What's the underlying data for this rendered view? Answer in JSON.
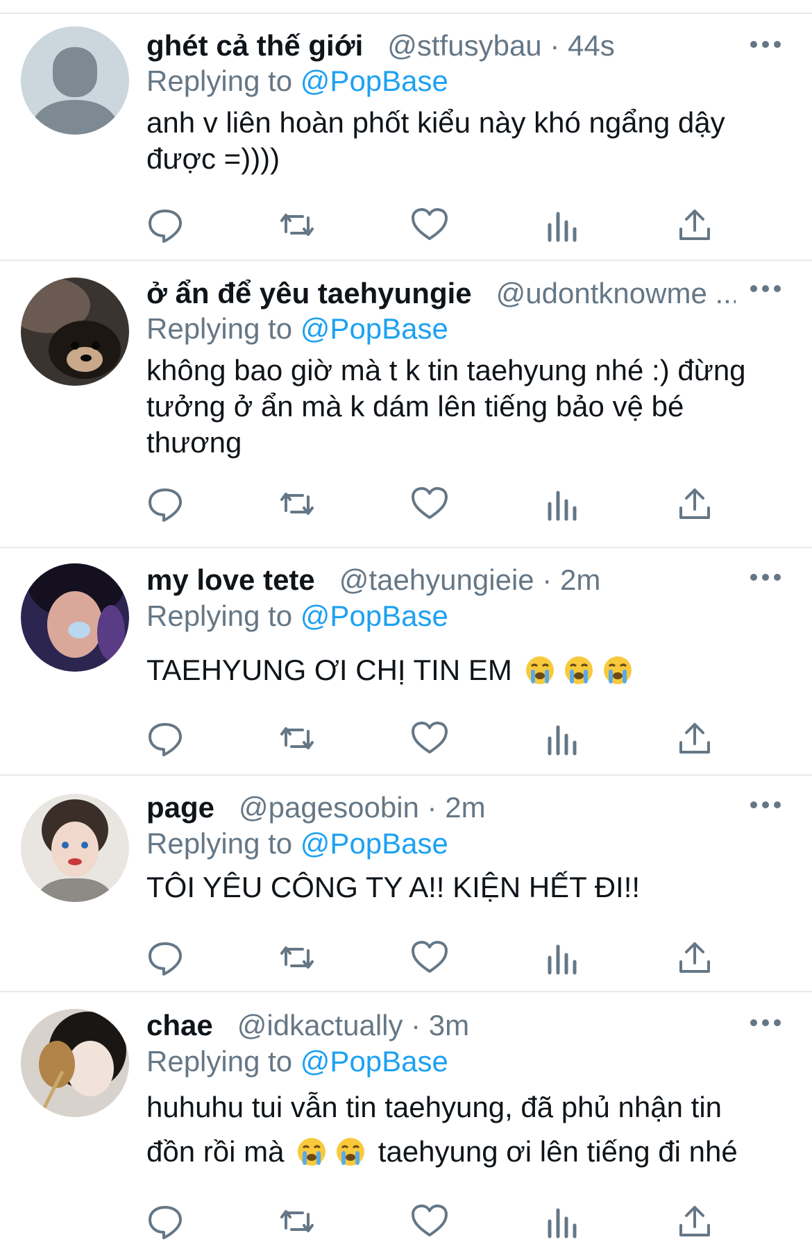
{
  "tweets": [
    {
      "name": "ghét cả thế giới",
      "handle": "@stfusybau · 44s",
      "replying_prefix": "Replying to",
      "replying_to": "@PopBase",
      "text": "anh v liên hoàn phốt kiểu này khó ngẩng dậy được =))))",
      "avatar": "default-avatar"
    },
    {
      "name": "ở ẩn để yêu taehyungie",
      "handle": "@udontknowme ...",
      "replying_prefix": "Replying to",
      "replying_to": "@PopBase",
      "text": "không bao giờ mà t k tin taehyung nhé :) đừng tưởng ở ẩn mà k dám lên tiếng bảo vệ bé thương",
      "avatar": "dog-photo-avatar"
    },
    {
      "name": "my love tete",
      "handle": "@taehyungieie · 2m",
      "replying_prefix": "Replying to",
      "replying_to": "@PopBase",
      "text": "TAEHYUNG ƠI CHỊ TIN EM",
      "emoji_count": 3,
      "avatar": "person-photo-avatar"
    },
    {
      "name": "page",
      "handle": "@pagesoobin · 2m",
      "replying_prefix": "Replying to",
      "replying_to": "@PopBase",
      "text": "TÔI YÊU CÔNG TY A!! KIỆN HẾT ĐI!!",
      "avatar": "person-photo-avatar"
    },
    {
      "name": "chae",
      "handle": "@idkactually · 3m",
      "replying_prefix": "Replying to",
      "replying_to": "@PopBase",
      "text_line1": "huhuhu tui vẫn tin taehyung, đã phủ nhận tin",
      "text_line2_a": "đồn rồi mà",
      "text_line2_b": "taehyung ơi lên tiếng đi nhé",
      "emoji_count": 2,
      "avatar": "person-photo-avatar"
    }
  ],
  "actions": [
    "reply-icon",
    "retweet-icon",
    "like-icon",
    "analytics-icon",
    "share-icon"
  ],
  "colors": {
    "link": "#1da1f2",
    "secondary": "#657786",
    "divider": "#e6e9ec",
    "icon": "#657786"
  }
}
